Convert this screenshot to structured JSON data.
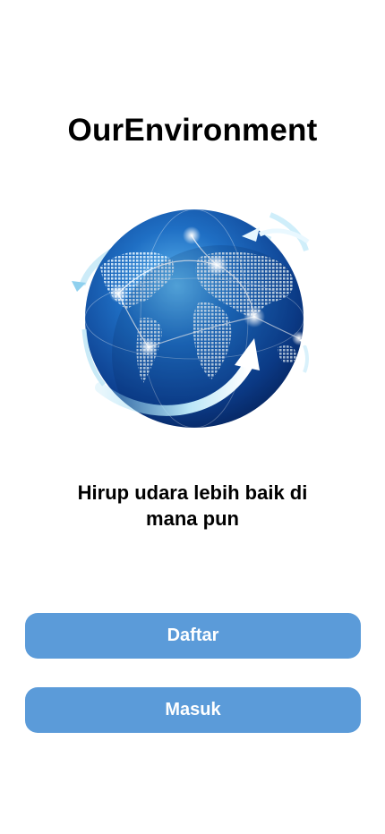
{
  "app": {
    "title": "OurEnvironment"
  },
  "hero": {
    "image_icon": "globe-network-icon",
    "tagline": "Hirup udara lebih baik di mana pun"
  },
  "actions": {
    "register_label": "Daftar",
    "login_label": "Masuk"
  },
  "colors": {
    "button_bg": "#5b9bd9",
    "button_text": "#ffffff",
    "background": "#ffffff",
    "text": "#000000"
  }
}
